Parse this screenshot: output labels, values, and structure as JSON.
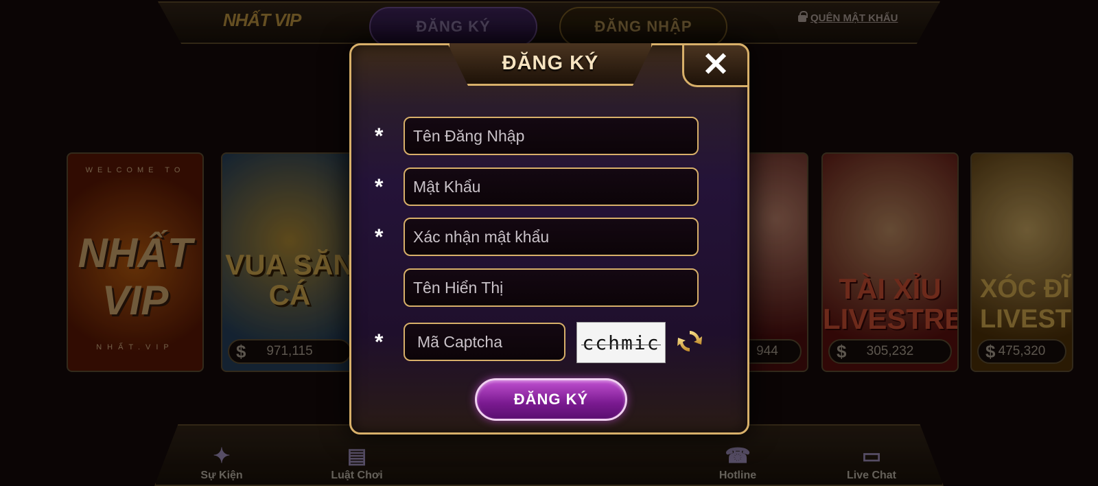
{
  "header": {
    "logo_text": "NHẤT VIP",
    "tab_register": "ĐĂNG KÝ",
    "tab_login": "ĐĂNG NHẬP",
    "forgot_password": "QUÊN MẬT KHẨU"
  },
  "game_cards": [
    {
      "title": "NHẤT VIP",
      "welcome": "WELCOME TO",
      "footer": "NHẤT.VIP"
    },
    {
      "title": "VUA SĂN CÁ",
      "amount": "971,115"
    },
    {
      "title": "",
      "amount": "944"
    },
    {
      "title": "TÀI XỈU LIVESTREAM",
      "amount": "305,232"
    },
    {
      "title": "XÓC ĐĨ LIVESTREA",
      "amount": "475,320"
    }
  ],
  "bottom_nav": {
    "event": "Sự Kiện",
    "rules": "Luật Chơi",
    "hotline": "Hotline",
    "chat": "Live Chat"
  },
  "modal": {
    "title": "ĐĂNG KÝ",
    "close_symbol": "✕",
    "required_mark": "*",
    "fields": {
      "username_placeholder": "Tên Đăng Nhập",
      "password_placeholder": "Mật Khẩu",
      "confirm_placeholder": "Xác nhận mật khẩu",
      "display_placeholder": "Tên Hiển Thị",
      "captcha_placeholder": "Mã Captcha"
    },
    "captcha_text": "cchmic",
    "submit_label": "ĐĂNG KÝ"
  },
  "colors": {
    "gold_border": "#d8b06a",
    "purple_button": "#7a1a90"
  }
}
